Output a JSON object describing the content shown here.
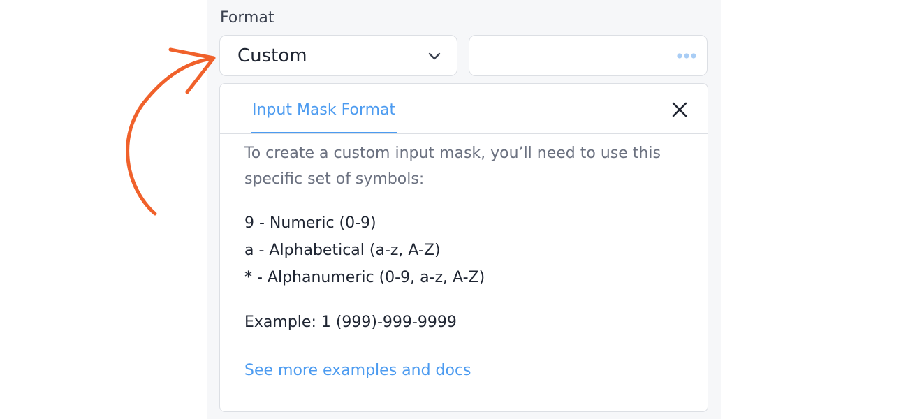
{
  "form": {
    "format_label": "Format",
    "select_value": "Custom",
    "mask_input_value": ""
  },
  "popover": {
    "tab_label": "Input Mask Format",
    "intro": "To create a custom input mask, you’ll need to use this specific set of symbols:",
    "symbols": [
      "9 - Numeric (0-9)",
      "a - Alphabetical (a-z, A-Z)",
      "* - Alphanumeric (0-9, a-z, A-Z)"
    ],
    "example": "Example: 1 (999)-999-9999",
    "docs_link": "See more examples and docs"
  },
  "icons": {
    "chevron": "chevron-down-icon",
    "more": "more-dots-icon",
    "close": "close-icon",
    "arrow": "curved-arrow-icon"
  },
  "colors": {
    "accent": "#4c9bf0",
    "arrow": "#f0612b",
    "text_primary": "#1f2532",
    "text_muted": "#6b7180",
    "border": "#dcdfe4",
    "dots": "#a9cdf5"
  }
}
